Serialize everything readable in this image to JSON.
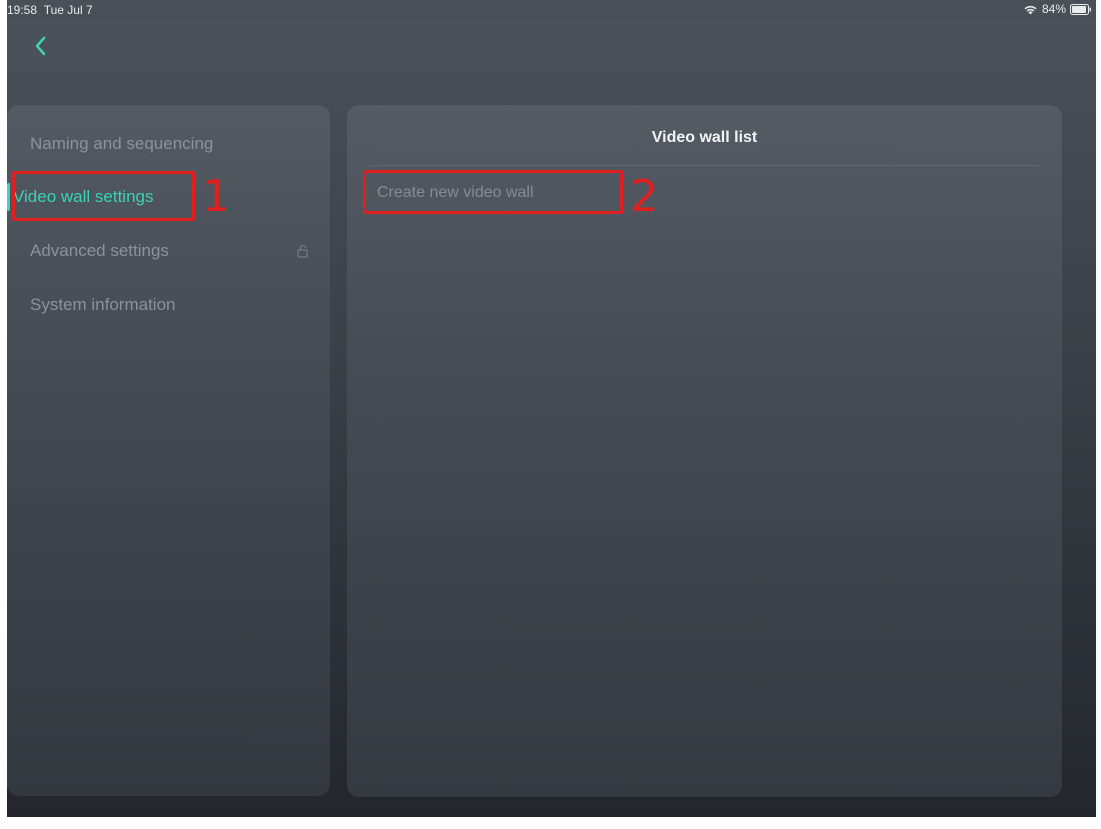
{
  "status_bar": {
    "time": "19:58",
    "date": "Tue Jul 7",
    "battery": "84%"
  },
  "nav": {
    "back_icon": "chevron-left-icon"
  },
  "sidebar": {
    "items": [
      {
        "label": "Naming and sequencing",
        "active": false
      },
      {
        "label": "Video wall settings",
        "active": true
      },
      {
        "label": "Advanced settings",
        "active": false,
        "icon": "lock-icon"
      },
      {
        "label": "System information",
        "active": false
      }
    ]
  },
  "main": {
    "title": "Video wall list",
    "create_button_label": "Create new video wall"
  },
  "annotations": [
    {
      "number": "1",
      "target": "Video wall settings"
    },
    {
      "number": "2",
      "target": "Create new video wall"
    }
  ],
  "colors": {
    "accent": "#3ad3b4",
    "annotation": "#e0201e"
  }
}
